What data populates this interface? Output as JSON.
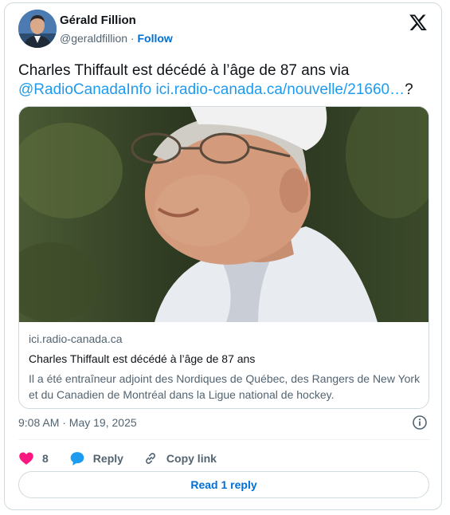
{
  "author": {
    "name": "Gérald Fillion",
    "handle": "@geraldfillion",
    "separator": " · ",
    "follow_label": "Follow"
  },
  "tweet": {
    "text_before": "Charles Thiffault est décédé à l’âge de 87 ans via ",
    "mention": "@RadioCanadaInfo",
    "space": " ",
    "link": "ici.radio-canada.ca/nouvelle/21660…",
    "text_after": "?"
  },
  "link_card": {
    "domain": "ici.radio-canada.ca",
    "title": "Charles Thiffault est décédé à l’âge de 87 ans",
    "description": "Il a été entraîneur adjoint des Nordiques de Québec, des Rangers de New York et du Canadien de Montréal dans la Ligue national de hockey."
  },
  "timestamp": "9:08 AM · May 19, 2025",
  "actions": {
    "likes_count": "8",
    "reply_label": "Reply",
    "copy_link_label": "Copy link"
  },
  "read_replies_label": "Read 1 reply",
  "icons": {
    "platform_logo": "x-logo-icon",
    "heart": "heart-icon",
    "reply": "speech-bubble-icon",
    "copy_link": "chain-link-icon",
    "info": "info-icon"
  },
  "colors": {
    "link_blue": "#1d9bf0",
    "follow_blue": "#006fd6",
    "heart_pink": "#f91880",
    "reply_blue": "#1d9bf0"
  }
}
